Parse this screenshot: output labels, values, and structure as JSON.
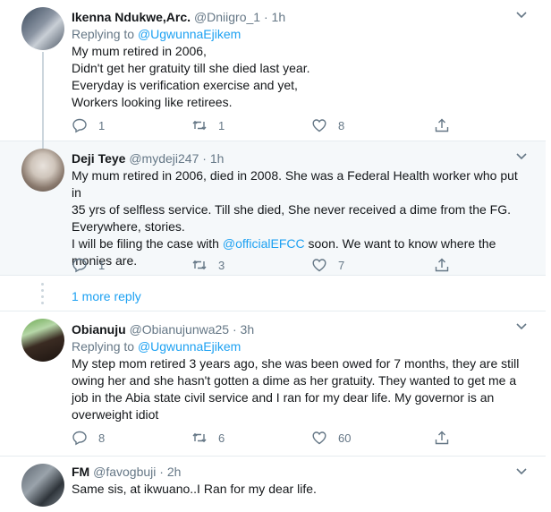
{
  "colors": {
    "link": "#1da1f2",
    "muted": "#657786",
    "text": "#14171a",
    "divider": "#e6ecf0",
    "highlight_bg": "#f5f8fa"
  },
  "tweets": [
    {
      "name": "Ikenna Ndukwe,Arc.",
      "handle": "@Dniigro_1",
      "separator": "·",
      "time": "1h",
      "reply_prefix": "Replying to",
      "reply_to": "@UgwunnaEjikem",
      "lines": [
        "My mum retired in 2006,",
        "Didn't get her gratuity till she died last year.",
        "Everyday is verification exercise and yet,",
        "Workers looking like retirees."
      ],
      "replies": "1",
      "retweets": "1",
      "likes": "8"
    },
    {
      "name": "Deji Teye",
      "handle": "@mydeji247",
      "separator": "·",
      "time": "1h",
      "lines": [
        "My mum retired in 2006, died in 2008. She was a Federal Health worker who put in",
        "35 yrs of selfless service. Till she died, She never received a  dime from the FG.",
        "Everywhere, stories."
      ],
      "line4_pre": "I will be filing the case with ",
      "line4_mention": "@officialEFCC",
      "line4_post": " soon. We want to know where the",
      "line5": "monies are.",
      "replies": "1",
      "retweets": "3",
      "likes": "7"
    },
    {
      "name": "Obianuju",
      "handle": "@Obianujunwa25",
      "separator": "·",
      "time": "3h",
      "reply_prefix": "Replying to",
      "reply_to": "@UgwunnaEjikem",
      "lines": [
        "My step mom retired 3 years ago, she was been owed for 7 months, they are still",
        "owing her and she hasn't gotten a dime as her gratuity. They wanted to get me a",
        "job in the Abia state civil service and I ran for my dear life. My governor is an",
        "overweight idiot"
      ],
      "replies": "8",
      "retweets": "6",
      "likes": "60"
    },
    {
      "name": "FM",
      "handle": "@favogbuji",
      "separator": "·",
      "time": "2h",
      "lines": [
        "Same sis, at ikwuano..I Ran for my dear life."
      ]
    }
  ],
  "more_replies": "1 more reply",
  "icons": [
    "reply-icon",
    "retweet-icon",
    "like-icon",
    "share-icon",
    "caret-down-icon"
  ]
}
